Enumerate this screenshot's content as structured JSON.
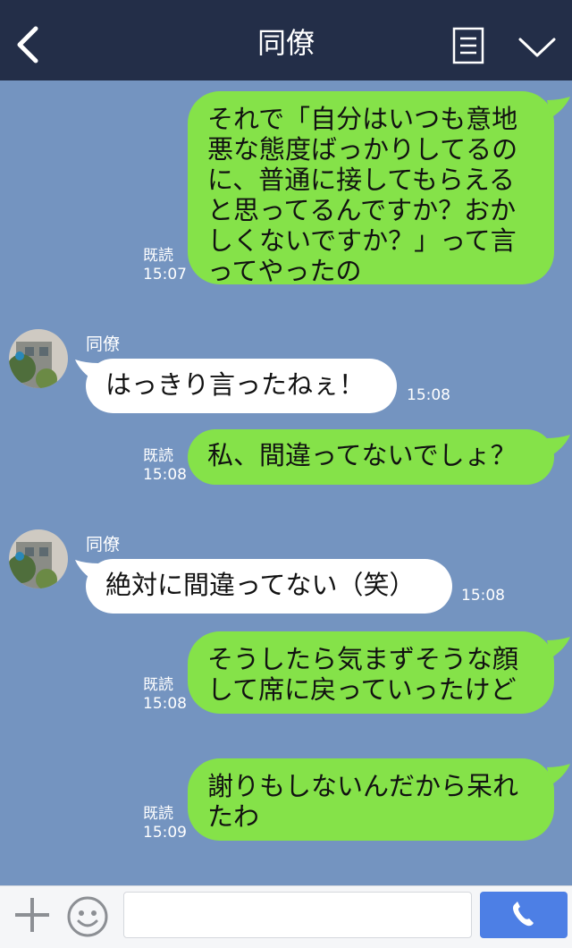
{
  "header": {
    "title": "同僚"
  },
  "messages": [
    {
      "type": "sent",
      "text": "それで「自分はいつも意地\n悪な態度ばっかりしてるの\nに、普通に接してもらえる\nと思ってるんですか？おか\nしくないですか？」って言\nってやったの",
      "read": "既読",
      "time": "15:07"
    },
    {
      "type": "recv",
      "sender": "同僚",
      "text": "はっきり言ったねぇ！",
      "time": "15:08"
    },
    {
      "type": "sent",
      "text": "私、間違ってないでしょ？",
      "read": "既読",
      "time": "15:08"
    },
    {
      "type": "recv",
      "sender": "同僚",
      "text": "絶対に間違ってない（笑）",
      "time": "15:08"
    },
    {
      "type": "sent",
      "text": "そうしたら気まずそうな顔\nして席に戻っていったけど",
      "read": "既読",
      "time": "15:08"
    },
    {
      "type": "sent",
      "text": "謝りもしないんだから呆れ\nたわ",
      "read": "既読",
      "time": "15:09"
    }
  ],
  "input": {
    "placeholder": ""
  },
  "colors": {
    "header": "#232e48",
    "background": "#7494c0",
    "sent_bubble": "#85e249",
    "recv_bubble": "#ffffff",
    "call_button": "#4d7fe5"
  },
  "icons": {
    "back": "chevron-left-icon",
    "menu": "menu-list-icon",
    "collapse": "chevron-down-icon",
    "add": "plus-icon",
    "emoji": "emoji-icon",
    "call": "phone-icon"
  }
}
